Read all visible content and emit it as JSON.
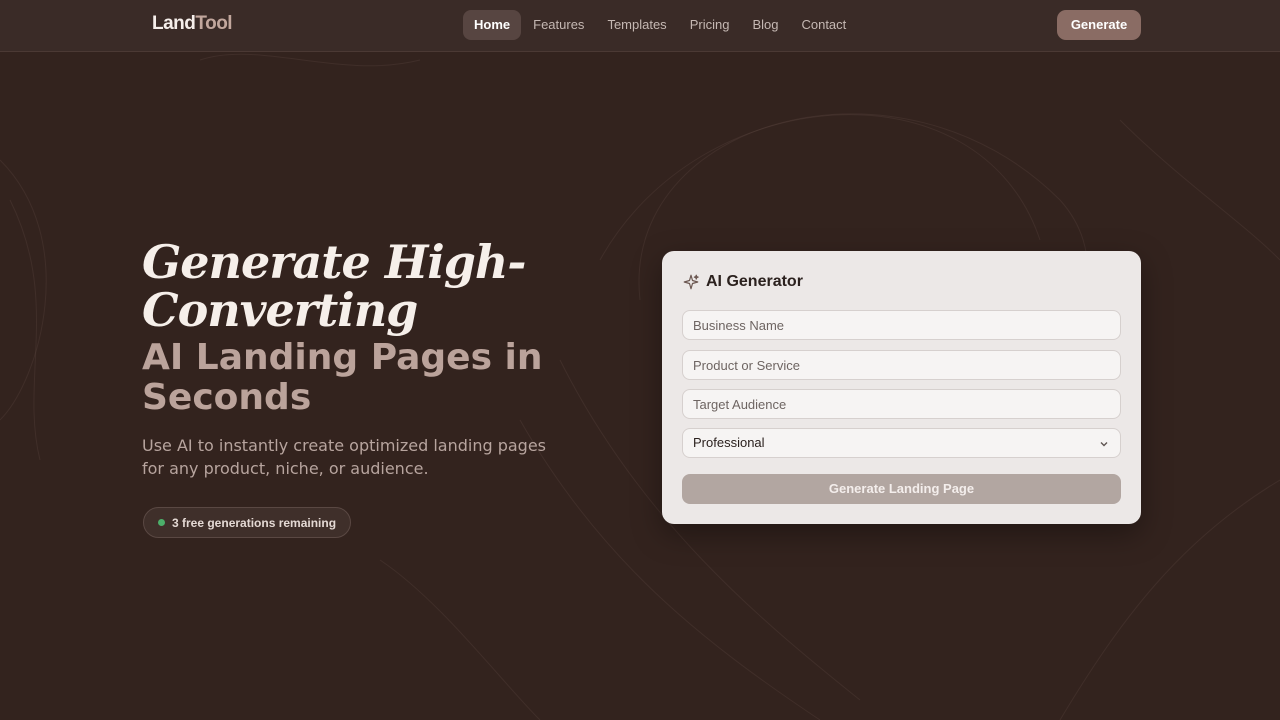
{
  "nav": {
    "logo_part1": "Land",
    "logo_part2": "Tool",
    "links": [
      {
        "label": "Home",
        "active": true
      },
      {
        "label": "Features",
        "active": false
      },
      {
        "label": "Templates",
        "active": false
      },
      {
        "label": "Pricing",
        "active": false
      },
      {
        "label": "Blog",
        "active": false
      },
      {
        "label": "Contact",
        "active": false
      }
    ],
    "cta_label": "Generate"
  },
  "hero": {
    "title_line1": "Generate High-",
    "title_line2": "Converting",
    "title_accent": "AI Landing Pages in Seconds",
    "subtitle": "Use AI to instantly create optimized landing pages for any product, niche, or audience.",
    "badge_text": "3 free generations remaining"
  },
  "generator": {
    "title": "AI Generator",
    "icon": "sparkle-icon",
    "business_placeholder": "Business Name",
    "product_placeholder": "Product or Service",
    "audience_placeholder": "Target Audience",
    "tone_selected": "Professional",
    "submit_label": "Generate Landing Page"
  },
  "colors": {
    "background": "#33231e",
    "nav_background": "#3a2b27",
    "accent": "#8a6c64",
    "badge_dot": "#4caf6a"
  }
}
